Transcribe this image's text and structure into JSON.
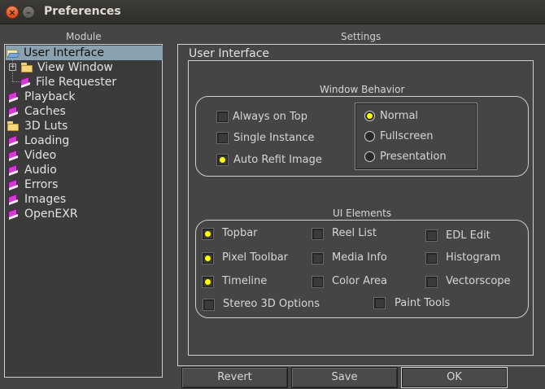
{
  "window": {
    "title": "Preferences",
    "close_glyph": "×",
    "minimize_glyph": "–"
  },
  "module": {
    "header": "Module",
    "items": [
      {
        "label": "User Interface",
        "icon": "open-folder-icon",
        "selected": true
      },
      {
        "label": "View Window",
        "icon": "folder-icon",
        "expander": "+"
      },
      {
        "label": "File Requester",
        "icon": "book-icon"
      },
      {
        "label": "Playback",
        "icon": "book-icon"
      },
      {
        "label": "Caches",
        "icon": "book-icon"
      },
      {
        "label": "3D Luts",
        "icon": "folder-icon"
      },
      {
        "label": "Loading",
        "icon": "book-icon"
      },
      {
        "label": "Video",
        "icon": "book-icon"
      },
      {
        "label": "Audio",
        "icon": "book-icon"
      },
      {
        "label": "Errors",
        "icon": "book-icon"
      },
      {
        "label": "Images",
        "icon": "book-icon"
      },
      {
        "label": "OpenEXR",
        "icon": "book-icon"
      }
    ]
  },
  "settings": {
    "header": "Settings",
    "page_title": "User Interface",
    "window_behavior": {
      "title": "Window Behavior",
      "checkboxes": [
        {
          "label": "Always on Top",
          "checked": false
        },
        {
          "label": "Single Instance",
          "checked": false
        },
        {
          "label": "Auto Refit Image",
          "checked": true
        }
      ],
      "radios": [
        {
          "label": "Normal",
          "checked": true
        },
        {
          "label": "Fullscreen",
          "checked": false
        },
        {
          "label": "Presentation",
          "checked": false
        }
      ]
    },
    "ui_elements": {
      "title": "UI Elements",
      "items": [
        {
          "label": "Topbar",
          "checked": true
        },
        {
          "label": "Reel List",
          "checked": false
        },
        {
          "label": "EDL Edit",
          "checked": false
        },
        {
          "label": "Pixel Toolbar",
          "checked": true
        },
        {
          "label": "Media Info",
          "checked": false
        },
        {
          "label": "Histogram",
          "checked": false
        },
        {
          "label": "Timeline",
          "checked": true
        },
        {
          "label": "Color Area",
          "checked": false
        },
        {
          "label": "Vectorscope",
          "checked": false
        },
        {
          "label": "Stereo 3D Options",
          "checked": false
        },
        {
          "label": "Paint Tools",
          "checked": false
        }
      ]
    }
  },
  "buttons": {
    "revert": "Revert",
    "save": "Save",
    "ok": "OK"
  },
  "colors": {
    "selection": "#8aa2b0",
    "check_mark": "#ffff00",
    "background": "#454545"
  }
}
